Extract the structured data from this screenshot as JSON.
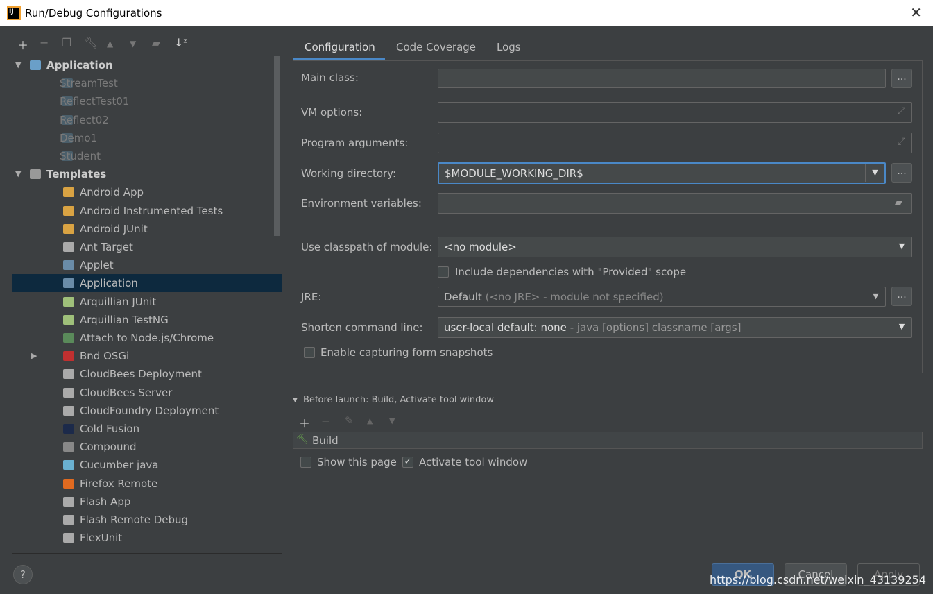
{
  "window": {
    "title": "Run/Debug Configurations"
  },
  "toolbar": [
    "add-icon",
    "remove-icon",
    "copy-icon",
    "wrench-icon",
    "move-up-icon",
    "move-down-icon",
    "new-folder-icon",
    "sort-icon"
  ],
  "tree": [
    {
      "label": "Application",
      "level": 0,
      "expanded": true,
      "bold": true,
      "icon": "application-icon",
      "color": "#6a9fc8"
    },
    {
      "label": "StreamTest",
      "level": 1,
      "dim": true,
      "icon": "application-icon",
      "color": "#4a5e6a"
    },
    {
      "label": "ReflectTest01",
      "level": 1,
      "dim": true,
      "icon": "application-icon",
      "color": "#4a5e6a"
    },
    {
      "label": "Reflect02",
      "level": 1,
      "dim": true,
      "icon": "application-icon",
      "color": "#4a5e6a"
    },
    {
      "label": "Demo1",
      "level": 1,
      "dim": true,
      "icon": "application-icon",
      "color": "#4a5e6a"
    },
    {
      "label": "Student",
      "level": 1,
      "dim": true,
      "icon": "application-icon",
      "color": "#4a5e6a"
    },
    {
      "label": "Templates",
      "level": 0,
      "expanded": true,
      "bold": true,
      "icon": "wrench-icon",
      "color": "#999"
    },
    {
      "label": "Android App",
      "level": 2,
      "icon": "android-icon",
      "color": "#d9a343"
    },
    {
      "label": "Android Instrumented Tests",
      "level": 2,
      "icon": "android-icon",
      "color": "#d9a343"
    },
    {
      "label": "Android JUnit",
      "level": 2,
      "icon": "android-icon",
      "color": "#d9a343"
    },
    {
      "label": "Ant Target",
      "level": 2,
      "icon": "ant-icon",
      "color": "#aaa"
    },
    {
      "label": "Applet",
      "level": 2,
      "icon": "applet-icon",
      "color": "#6a8ca8"
    },
    {
      "label": "Application",
      "level": 2,
      "selected": true,
      "icon": "application-icon",
      "color": "#6a8ca8"
    },
    {
      "label": "Arquillian JUnit",
      "level": 2,
      "icon": "arquillian-icon",
      "color": "#9fc07a"
    },
    {
      "label": "Arquillian TestNG",
      "level": 2,
      "icon": "arquillian-icon",
      "color": "#9fc07a"
    },
    {
      "label": "Attach to Node.js/Chrome",
      "level": 2,
      "icon": "nodejs-icon",
      "color": "#5a8a5a"
    },
    {
      "label": "Bnd OSGi",
      "level": 2,
      "collapsed": true,
      "icon": "bnd-icon",
      "color": "#c03030"
    },
    {
      "label": "CloudBees Deployment",
      "level": 2,
      "icon": "cloud-icon",
      "color": "#aaa"
    },
    {
      "label": "CloudBees Server",
      "level": 2,
      "icon": "cloud-icon",
      "color": "#aaa"
    },
    {
      "label": "CloudFoundry Deployment",
      "level": 2,
      "icon": "cloud-icon",
      "color": "#aaa"
    },
    {
      "label": "Cold Fusion",
      "level": 2,
      "icon": "coldfusion-icon",
      "color": "#1c2a4a"
    },
    {
      "label": "Compound",
      "level": 2,
      "icon": "folder-icon",
      "color": "#888"
    },
    {
      "label": "Cucumber java",
      "level": 2,
      "icon": "cucumber-icon",
      "color": "#6ab0d0"
    },
    {
      "label": "Firefox Remote",
      "level": 2,
      "icon": "firefox-icon",
      "color": "#e06a20"
    },
    {
      "label": "Flash App",
      "level": 2,
      "icon": "flash-icon",
      "color": "#aaa"
    },
    {
      "label": "Flash Remote Debug",
      "level": 2,
      "icon": "flash-icon",
      "color": "#aaa"
    },
    {
      "label": "FlexUnit",
      "level": 2,
      "icon": "flex-icon",
      "color": "#aaa"
    }
  ],
  "tabs": [
    {
      "label": "Configuration",
      "active": true
    },
    {
      "label": "Code Coverage"
    },
    {
      "label": "Logs"
    }
  ],
  "form": {
    "main_class": {
      "label": "Main class:",
      "value": ""
    },
    "vm_options": {
      "label": "VM options:",
      "value": ""
    },
    "program_arguments": {
      "label": "Program arguments:",
      "value": ""
    },
    "working_directory": {
      "label": "Working directory:",
      "value": "$MODULE_WORKING_DIR$"
    },
    "environment_variables": {
      "label": "Environment variables:",
      "value": ""
    },
    "classpath_module": {
      "label": "Use classpath of module:",
      "value": "<no module>"
    },
    "include_provided": {
      "label": "Include dependencies with \"Provided\" scope",
      "checked": false
    },
    "jre": {
      "label": "JRE:",
      "value": "Default",
      "hint": "(<no JRE> - module not specified)"
    },
    "shorten_command_line": {
      "label": "Shorten command line:",
      "value": "user-local default: none",
      "hint": "- java [options] classname [args]"
    },
    "capture_snapshots": {
      "label": "Enable capturing form snapshots",
      "checked": false
    },
    "browse_label": "..."
  },
  "before_launch": {
    "title": "Before launch: Build, Activate tool window",
    "items": [
      "Build"
    ],
    "show_this_page": {
      "label": "Show this page",
      "checked": false
    },
    "activate_tool_window": {
      "label": "Activate tool window",
      "checked": true
    }
  },
  "buttons": {
    "ok": "OK",
    "cancel": "Cancel",
    "apply": "Apply",
    "help": "?"
  },
  "watermark": "https://blog.csdn.net/weixin_43139254",
  "colors": {
    "accent": "#4a88c7",
    "selected_row": "#0d293e",
    "ok_button": "#365880"
  }
}
